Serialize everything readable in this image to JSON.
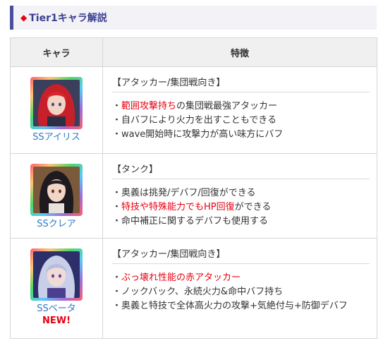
{
  "heading": {
    "marker": "◆",
    "title": "Tier1キャラ解説"
  },
  "table": {
    "headers": {
      "character": "キャラ",
      "features": "特徴"
    },
    "rows": [
      {
        "name": "SSアイリス",
        "new_label": "",
        "role": "【アタッカー/集団戦向き】",
        "bullets": [
          {
            "prefix": "・",
            "hl": "範囲攻撃持ち",
            "rest": "の集団戦最強アタッカー"
          },
          {
            "prefix": "・",
            "hl": "",
            "rest": "自バフにより火力を出すこともできる"
          },
          {
            "prefix": "・",
            "hl": "",
            "rest": "wave開始時に攻撃力が高い味方にバフ"
          }
        ]
      },
      {
        "name": "SSクレア",
        "new_label": "",
        "role": "【タンク】",
        "bullets": [
          {
            "prefix": "・",
            "hl": "",
            "rest": "奥義は挑発/デバフ/回復ができる"
          },
          {
            "prefix": "・",
            "hl": "特技や特殊能力でもHP回復",
            "rest": "ができる"
          },
          {
            "prefix": "・",
            "hl": "",
            "rest": "命中補正に関するデバフも使用する"
          }
        ]
      },
      {
        "name": "SSベータ",
        "new_label": "NEW!",
        "role": "【アタッカー/集団戦向き】",
        "bullets": [
          {
            "prefix": "・",
            "hl": "ぶっ壊れ性能の赤アタッカー",
            "rest": ""
          },
          {
            "prefix": "・",
            "hl": "",
            "rest": "ノックバック、永続火力&命中バフ持ち"
          },
          {
            "prefix": "・",
            "hl": "",
            "rest": "奥義と特技で全体高火力の攻撃+気絶付与+防御デバフ"
          }
        ]
      }
    ]
  },
  "colors": {
    "accent": "#4a4f9b",
    "highlight": "#e60012",
    "link": "#2b79c7"
  }
}
